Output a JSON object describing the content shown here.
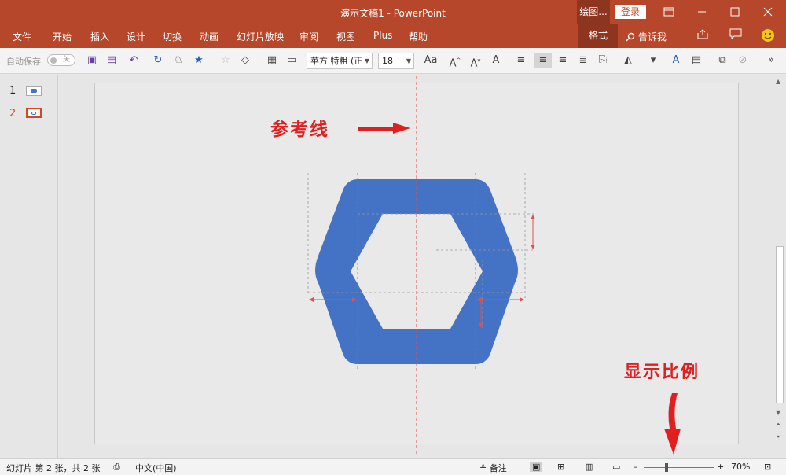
{
  "titlebar": {
    "title": "演示文稿1  -  PowerPoint",
    "draw_tab": "绘图...",
    "login": "登录"
  },
  "menu": {
    "items": [
      "文件",
      "开始",
      "插入",
      "设计",
      "切换",
      "动画",
      "幻灯片放映",
      "审阅",
      "视图",
      "Plus",
      "帮助"
    ],
    "format_tab": "格式",
    "tell_me": "告诉我"
  },
  "toolbar": {
    "autosave_label": "自动保存",
    "autosave_state": "关",
    "font_name": "苹方 特粗 (正",
    "font_size": "18",
    "aa_label": "Aa"
  },
  "slides": {
    "numbers": [
      "1",
      "2"
    ],
    "selected": 2
  },
  "annotations": {
    "guide_line": "参考线",
    "zoom_ratio": "显示比例"
  },
  "status": {
    "slide_info": "幻灯片 第 2 张，共 2 张",
    "language": "中文(中国)",
    "notes": "备注",
    "zoom": "70%"
  },
  "colors": {
    "brand": "#b7472a",
    "shape": "#4472c4",
    "guide": "#e05050"
  }
}
